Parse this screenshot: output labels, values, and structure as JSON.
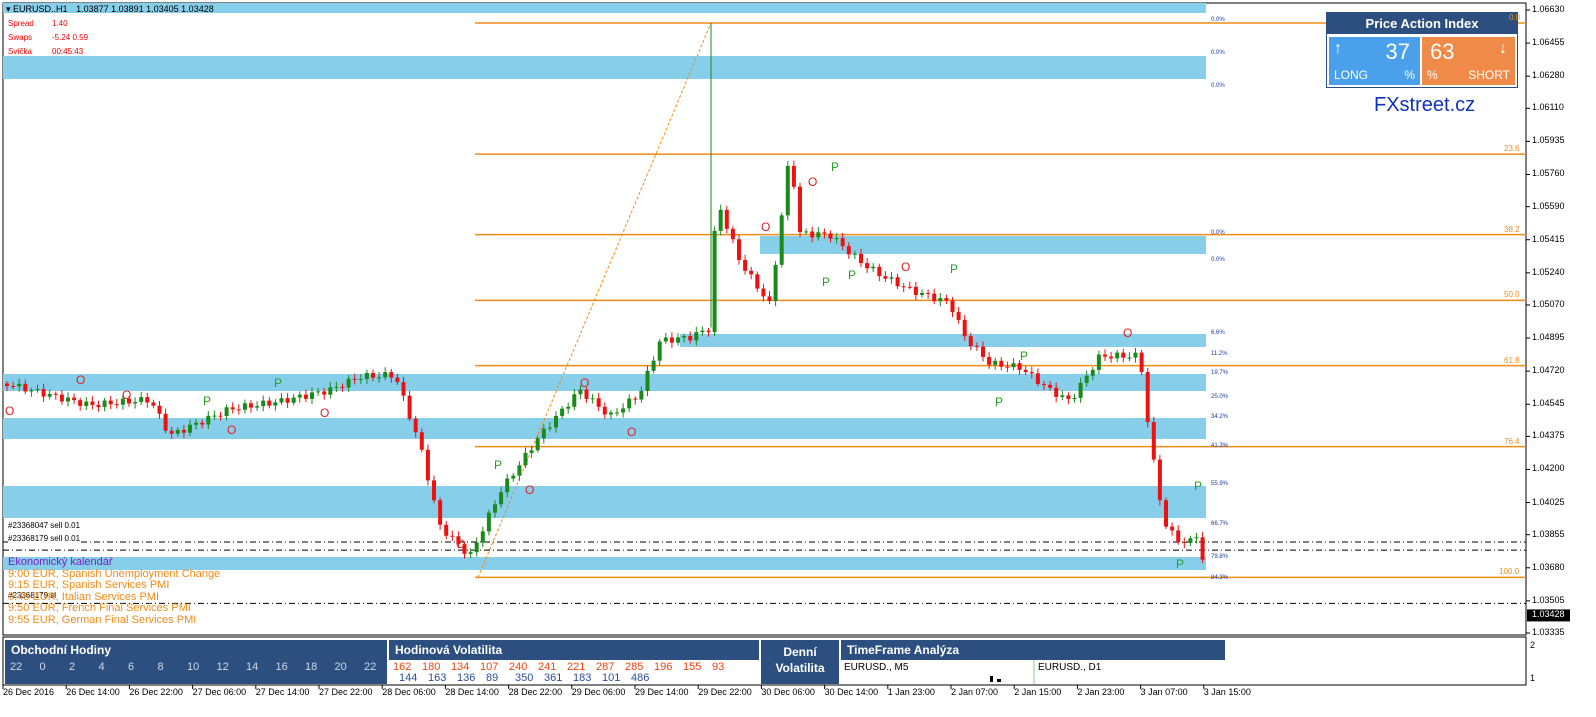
{
  "header": {
    "symbol": "EURUSD..H1",
    "ohlc": "1.03877 1.03891 1.03405 1.03428",
    "info": [
      {
        "label": "Spread",
        "value": "1.40"
      },
      {
        "label": "Swaps",
        "value": "-5.24 0.59"
      },
      {
        "label": "Svíčka",
        "value": "00:45:43"
      }
    ]
  },
  "price_axis": {
    "labels": [
      "1.06630",
      "1.06455",
      "1.06280",
      "1.06110",
      "1.05935",
      "1.05760",
      "1.05590",
      "1.05415",
      "1.05240",
      "1.05070",
      "1.04895",
      "1.04720",
      "1.04545",
      "1.04375",
      "1.04200",
      "1.04025",
      "1.03855",
      "1.03680",
      "1.03505",
      "1.03335"
    ],
    "current_price": "1.03428",
    "range": [
      1.03335,
      1.0663
    ]
  },
  "time_axis": {
    "labels": [
      "26 Dec 2016",
      "26 Dec 14:00",
      "26 Dec 22:00",
      "27 Dec 06:00",
      "27 Dec 14:00",
      "27 Dec 22:00",
      "28 Dec 06:00",
      "28 Dec 14:00",
      "28 Dec 22:00",
      "29 Dec 06:00",
      "29 Dec 14:00",
      "29 Dec 22:00",
      "30 Dec 06:00",
      "30 Dec 14:00",
      "1 Jan 23:00",
      "2 Jan 07:00",
      "2 Jan 15:00",
      "2 Jan 23:00",
      "3 Jan 07:00",
      "3 Jan 15:00"
    ]
  },
  "fibonacci": {
    "levels": [
      {
        "label": "0.0",
        "price": 1.06561
      },
      {
        "label": "23.6",
        "price": 1.05868
      },
      {
        "label": "38.2",
        "price": 1.05442
      },
      {
        "label": "50.0",
        "price": 1.05094
      },
      {
        "label": "61.8",
        "price": 1.04749
      },
      {
        "label": "76.4",
        "price": 1.04321
      },
      {
        "label": "100.0",
        "price": 1.03629
      }
    ],
    "color": "#f08c18"
  },
  "zones": {
    "color": "#87ceeb",
    "percent_labels": [
      "0.0%",
      "0.0%",
      "0.0%",
      "0.0%",
      "0.0%",
      "6.6%",
      "11.2%",
      "19.7%",
      "25.0%",
      "34.2%",
      "41.3%",
      "55.9%",
      "66.7%",
      "79.8%",
      "84.3%"
    ]
  },
  "orders": [
    {
      "label": "#23368047 sell 0.01",
      "price": 1.03816
    },
    {
      "label": "#23368179 sell 0.01",
      "price": 1.03773
    },
    {
      "label": "#23368179 sl",
      "price": 1.03492
    }
  ],
  "calendar": {
    "title": "Ekonomický kalendář",
    "items": [
      "9:00 EUR, Spanish Unemployment Change",
      "9:15 EUR, Spanish Services PMI",
      "9:45 EUR, Italian Services PMI",
      "9:50 EUR, French Final Services PMI",
      "9:55 EUR, German Final Services PMI"
    ]
  },
  "price_action_index": {
    "title": "Price Action Index",
    "long_value": "37",
    "short_value": "63",
    "long_label": "LONG",
    "short_label": "SHORT",
    "percent_sign": "%",
    "long_color": "#4aa0ea",
    "short_color": "#f08a48",
    "arrow_up": "↑",
    "arrow_down": "↓"
  },
  "brand": "FXstreet.cz",
  "panels": {
    "trading_hours": {
      "title": "Obchodní Hodiny",
      "hours": [
        "22",
        "0",
        "2",
        "4",
        "6",
        "8",
        "10",
        "12",
        "14",
        "16",
        "18",
        "20",
        "22"
      ]
    },
    "hourly_volatility": {
      "title": "Hodinová Volatilita",
      "top_row": [
        "162",
        "180",
        "134",
        "107",
        "240",
        "241",
        "221",
        "287",
        "285",
        "196",
        "155",
        "93"
      ],
      "bottom_row": [
        "144",
        "163",
        "136",
        "89",
        "350",
        "361",
        "183",
        "101",
        "486"
      ]
    },
    "daily_volatility": {
      "title_line1": "Denní",
      "title_line2": "Volatilita"
    },
    "timeframe_analysis": {
      "title": "TimeFrame Analýza",
      "labels": [
        "EURUSD., M5",
        "EURUSD., D1"
      ]
    }
  },
  "sub_window_axis": {
    "labels": [
      "2",
      "1"
    ]
  },
  "signals": {
    "o_label": "O",
    "p_label": "P"
  }
}
